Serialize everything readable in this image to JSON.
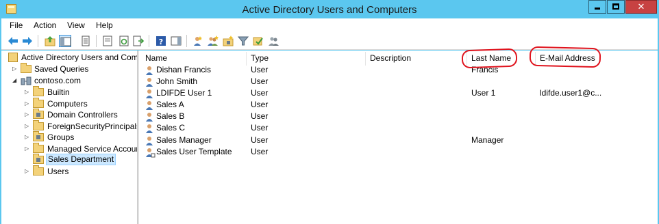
{
  "window": {
    "title": "Active Directory Users and Computers"
  },
  "menu": [
    "File",
    "Action",
    "View",
    "Help"
  ],
  "toolbar": {
    "icons": [
      "back-arrow-icon",
      "forward-arrow-icon",
      "up-folder-icon",
      "show-hide-console-tree-icon",
      "properties-icon",
      "export-list-icon",
      "refresh-icon",
      "export-icon",
      "help-icon",
      "action-pane-icon",
      "new-user-icon",
      "new-group-icon",
      "new-ou-icon",
      "filter-icon",
      "find-icon",
      "delegate-icon"
    ]
  },
  "tree": {
    "root": "Active Directory Users and Com",
    "items": [
      {
        "label": "Saved Queries"
      },
      {
        "label": "contoso.com"
      },
      {
        "label": "Builtin"
      },
      {
        "label": "Computers"
      },
      {
        "label": "Domain Controllers"
      },
      {
        "label": "ForeignSecurityPrincipals"
      },
      {
        "label": "Groups"
      },
      {
        "label": "Managed Service Accour"
      },
      {
        "label": "Sales Department"
      },
      {
        "label": "Users"
      }
    ]
  },
  "list": {
    "columns": [
      "Name",
      "Type",
      "Description",
      "Last Name",
      "E-Mail Address"
    ],
    "rows": [
      {
        "name": "Dishan Francis",
        "type": "User",
        "description": "",
        "last_name": "Francis",
        "email": ""
      },
      {
        "name": "John Smith",
        "type": "User",
        "description": "",
        "last_name": "",
        "email": ""
      },
      {
        "name": "LDIFDE User 1",
        "type": "User",
        "description": "",
        "last_name": "User 1",
        "email": "ldifde.user1@c..."
      },
      {
        "name": "Sales A",
        "type": "User",
        "description": "",
        "last_name": "",
        "email": ""
      },
      {
        "name": "Sales B",
        "type": "User",
        "description": "",
        "last_name": "",
        "email": ""
      },
      {
        "name": "Sales C",
        "type": "User",
        "description": "",
        "last_name": "",
        "email": ""
      },
      {
        "name": "Sales Manager",
        "type": "User",
        "description": "",
        "last_name": "Manager",
        "email": ""
      },
      {
        "name": "Sales User Template",
        "type": "User",
        "description": "",
        "last_name": "",
        "email": ""
      }
    ]
  },
  "colors": {
    "titlebar": "#5bc7ef",
    "close_button": "#c74242",
    "selection": "#cce8ff",
    "annotation": "#e0141e"
  }
}
